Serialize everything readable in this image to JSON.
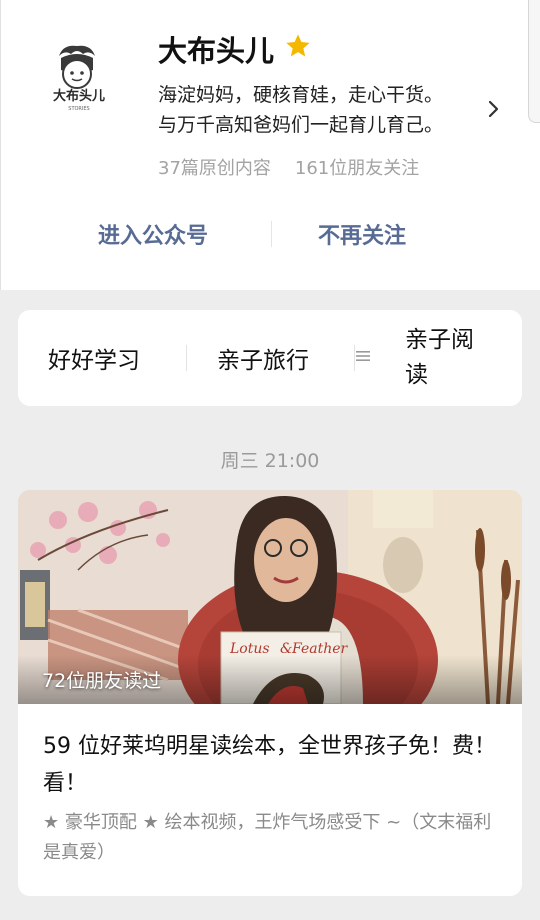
{
  "account": {
    "name": "大布头儿",
    "avatar_text": "大布头儿",
    "avatar_subtext": "STORIES",
    "bio_lines": [
      "海淀妈妈，硬核育娃，走心干货。",
      "与万千高知爸妈们一起育儿育己。"
    ],
    "stats": {
      "original": "37篇原创内容",
      "friends": "161位朋友关注"
    },
    "actions": {
      "enter": "进入公众号",
      "unfollow": "不再关注"
    }
  },
  "menu": {
    "items": [
      "好好学习",
      "亲子旅行",
      "亲子阅读"
    ],
    "items_wrapped": [
      "亲子阅",
      "读"
    ]
  },
  "feed": {
    "time": "周三 21:00",
    "article": {
      "read_badge": "72位朋友读过",
      "title": "59 位好莱坞明星读绘本，全世界孩子免！费！看！",
      "desc": "★ 豪华顶配 ★ 绘本视频，王炸气场感受下 ~（文末福利是真爱）",
      "book_title_a": "Lotus",
      "book_title_b": "Feather"
    }
  },
  "icons": {
    "star": "star-icon",
    "chevron": "chevron-right-icon",
    "menu": "menu-icon"
  },
  "colors": {
    "link": "#576b95",
    "star": "#f5b800",
    "background": "#ededed"
  }
}
